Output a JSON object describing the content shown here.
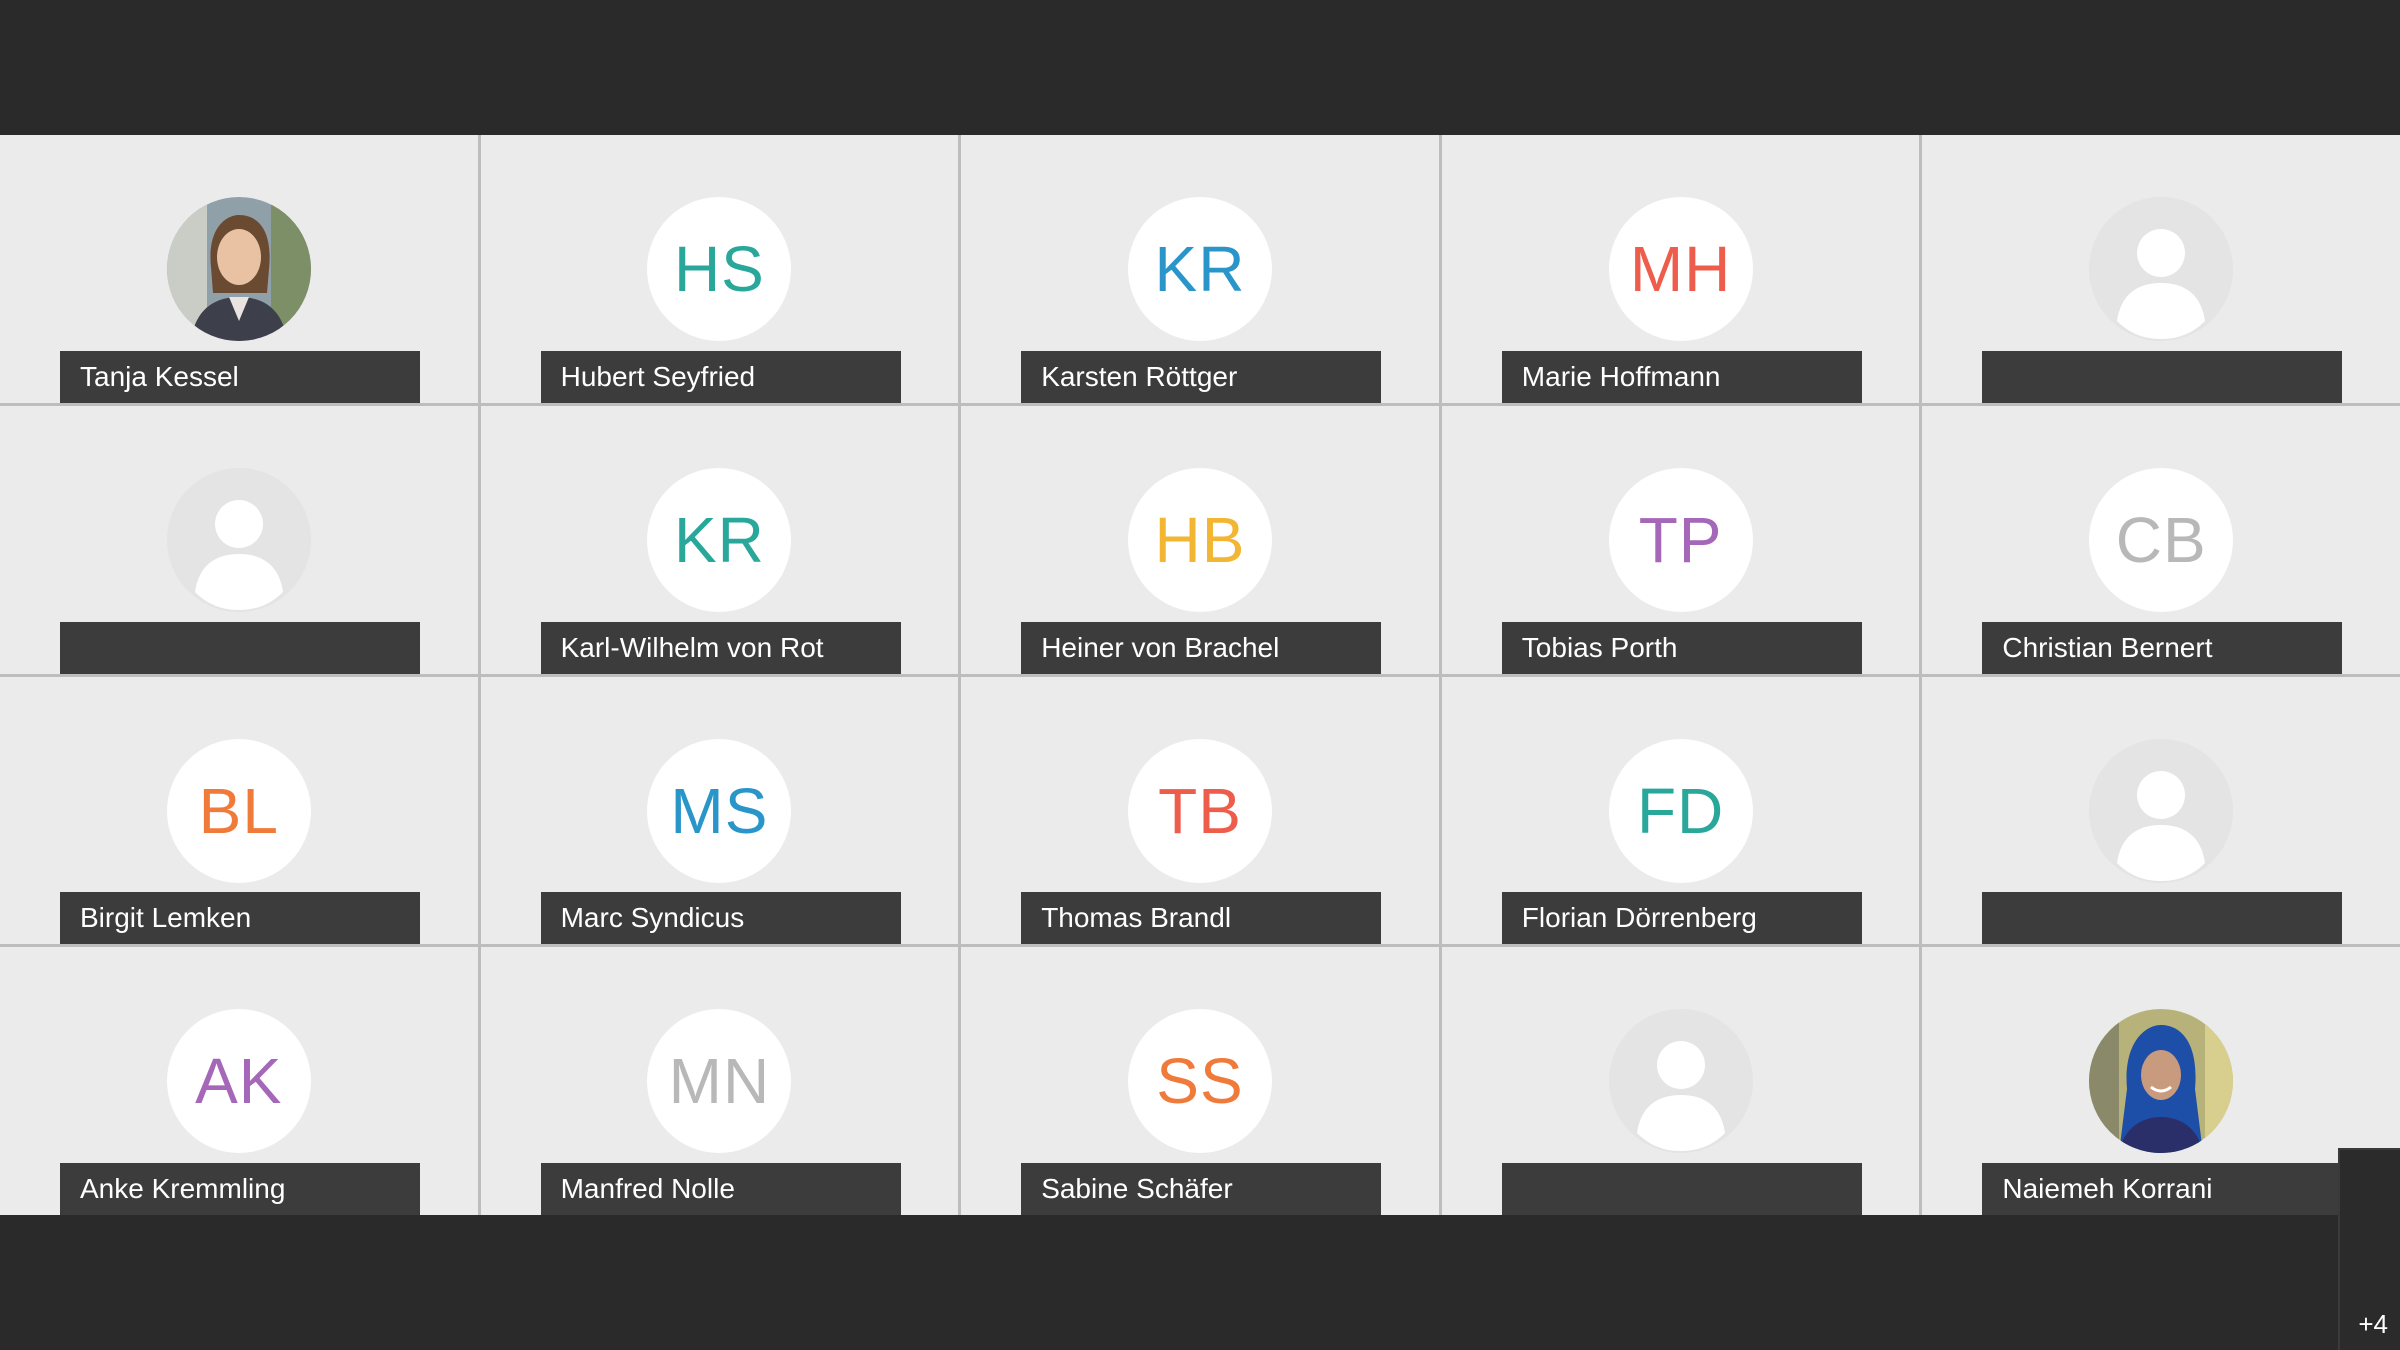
{
  "participants": [
    {
      "name": "Tanja Kessel",
      "type": "photo",
      "photo": "woman-brown-hair-photo"
    },
    {
      "name": "Hubert Seyfried",
      "type": "initials",
      "initials": "HS",
      "color": "#2aa79b"
    },
    {
      "name": "Karsten Röttger",
      "type": "initials",
      "initials": "KR",
      "color": "#2a95c9"
    },
    {
      "name": "Marie Hoffmann",
      "type": "initials",
      "initials": "MH",
      "color": "#ee5d4b"
    },
    {
      "name": "",
      "type": "default"
    },
    {
      "name": "",
      "type": "default"
    },
    {
      "name": "Karl-Wilhelm von Rot",
      "type": "initials",
      "initials": "KR",
      "color": "#2aa79b"
    },
    {
      "name": "Heiner von Brachel",
      "type": "initials",
      "initials": "HB",
      "color": "#f2b632"
    },
    {
      "name": "Tobias Porth",
      "type": "initials",
      "initials": "TP",
      "color": "#a567b8"
    },
    {
      "name": "Christian Bernert",
      "type": "initials",
      "initials": "CB",
      "color": "#b8b8b8"
    },
    {
      "name": "Birgit Lemken",
      "type": "initials",
      "initials": "BL",
      "color": "#f07a3a"
    },
    {
      "name": "Marc Syndicus",
      "type": "initials",
      "initials": "MS",
      "color": "#2a95c9"
    },
    {
      "name": "Thomas Brandl",
      "type": "initials",
      "initials": "TB",
      "color": "#ee5d4b"
    },
    {
      "name": "Florian Dörrenberg",
      "type": "initials",
      "initials": "FD",
      "color": "#2aa79b"
    },
    {
      "name": "",
      "type": "default"
    },
    {
      "name": "Anke Kremmling",
      "type": "initials",
      "initials": "AK",
      "color": "#a567b8"
    },
    {
      "name": "Manfred Nolle",
      "type": "initials",
      "initials": "MN",
      "color": "#b8b8b8"
    },
    {
      "name": "Sabine Schäfer",
      "type": "initials",
      "initials": "SS",
      "color": "#f07a3a"
    },
    {
      "name": "",
      "type": "default"
    },
    {
      "name": "Naiemeh Korrani",
      "type": "photo",
      "photo": "woman-blue-headscarf-photo"
    }
  ],
  "overflow": {
    "label": "+4"
  }
}
